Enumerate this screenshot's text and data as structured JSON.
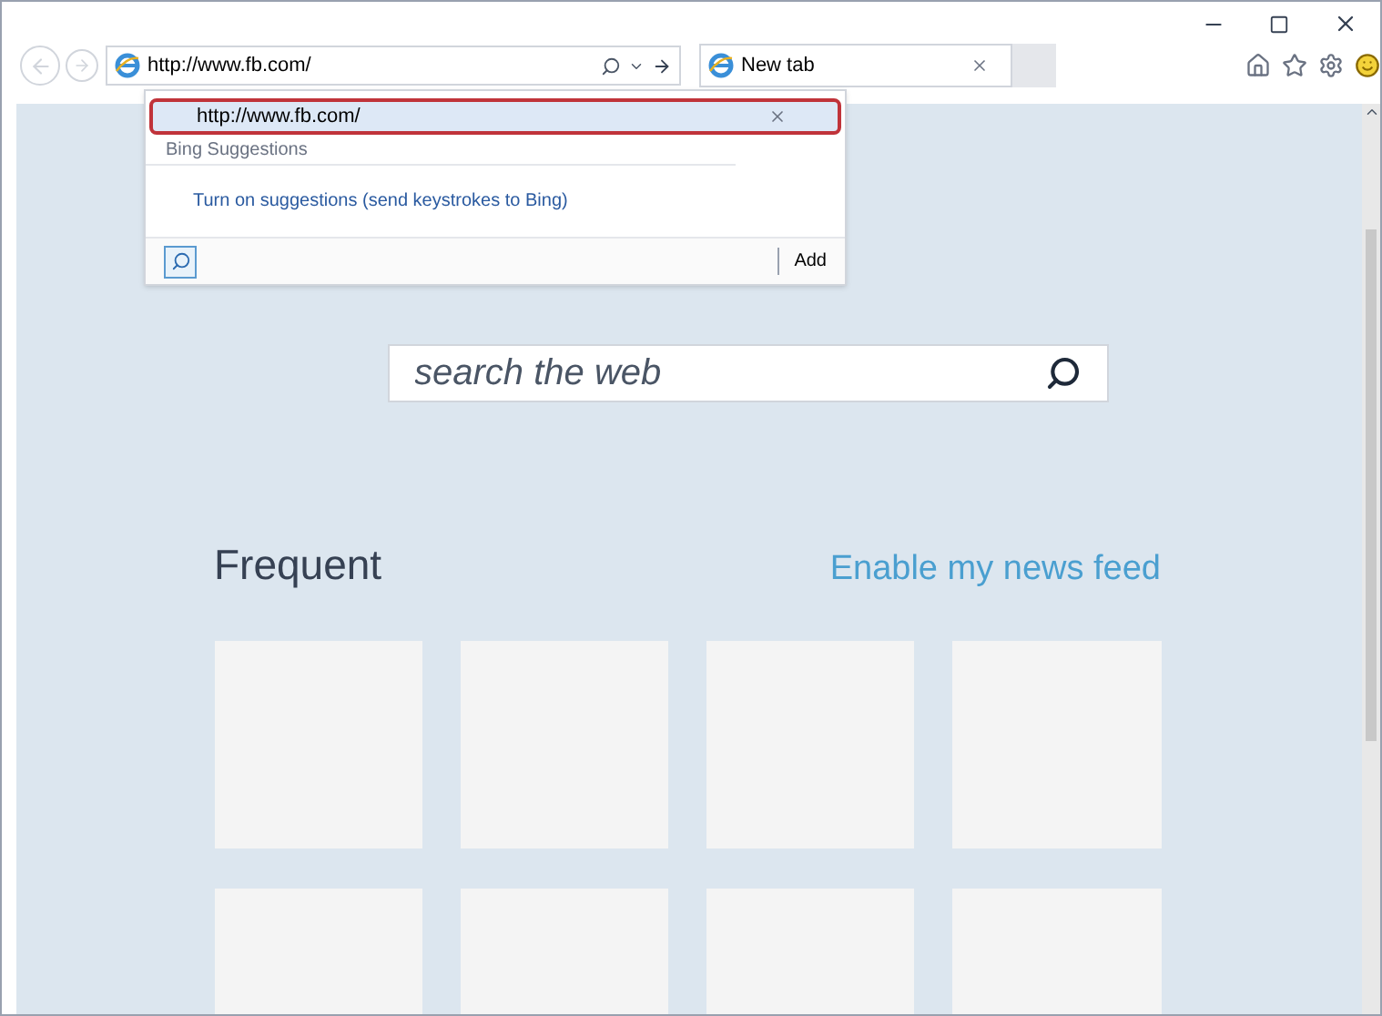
{
  "address_bar": {
    "value": "http://www.fb.com/"
  },
  "tabs": [
    {
      "title": "New tab",
      "selected": true
    }
  ],
  "autocomplete": {
    "items": [
      {
        "text": "http://www.fb.com/",
        "selected": true
      }
    ],
    "section": "Bing Suggestions",
    "suggestion_link": "Turn on suggestions (send keystrokes to Bing)",
    "add_button": "Add"
  },
  "search": {
    "placeholder": "search the web"
  },
  "frequent": {
    "heading": "Frequent",
    "link": "Enable my news feed"
  }
}
